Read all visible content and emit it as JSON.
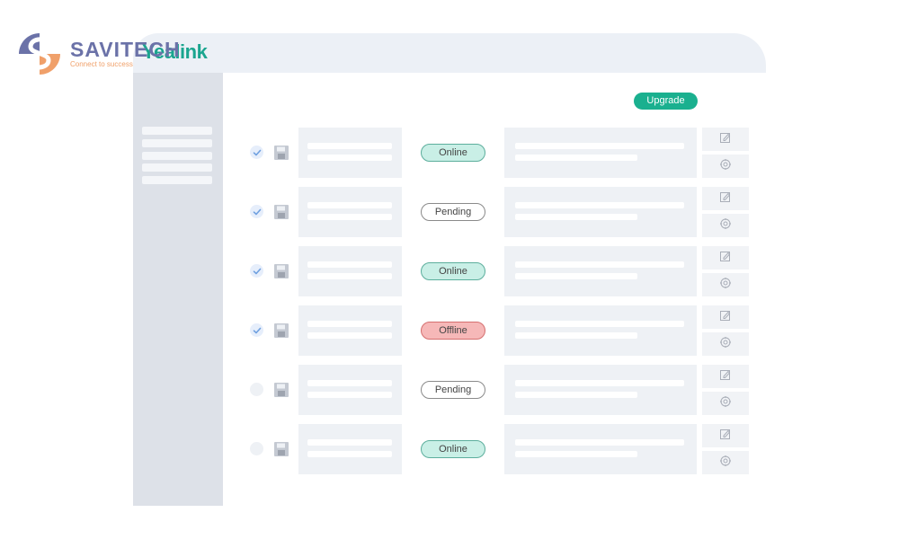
{
  "logo": {
    "name": "SAVITECH",
    "tagline": "Connect to success",
    "primary_color": "#6b72a8",
    "accent_color": "#f0a06a"
  },
  "window": {
    "brand": "Yealink",
    "brand_color": "#1aa58f"
  },
  "sidebar": {
    "item_count": 5
  },
  "toolbar": {
    "upgrade_label": "Upgrade"
  },
  "status_colors": {
    "online": "#c9efe6",
    "offline": "#f6b8b8",
    "pending": "#ffffff"
  },
  "devices": [
    {
      "checked": true,
      "status": "Online",
      "status_type": "online"
    },
    {
      "checked": true,
      "status": "Pending",
      "status_type": "pending"
    },
    {
      "checked": true,
      "status": "Online",
      "status_type": "online"
    },
    {
      "checked": true,
      "status": "Offline",
      "status_type": "offline"
    },
    {
      "checked": false,
      "status": "Pending",
      "status_type": "pending"
    },
    {
      "checked": false,
      "status": "Online",
      "status_type": "online"
    }
  ],
  "icons": {
    "row_check": "checkmark-icon",
    "row_save": "floppy-disk-icon",
    "action_edit": "edit-icon",
    "action_settings": "settings-gear-icon"
  }
}
